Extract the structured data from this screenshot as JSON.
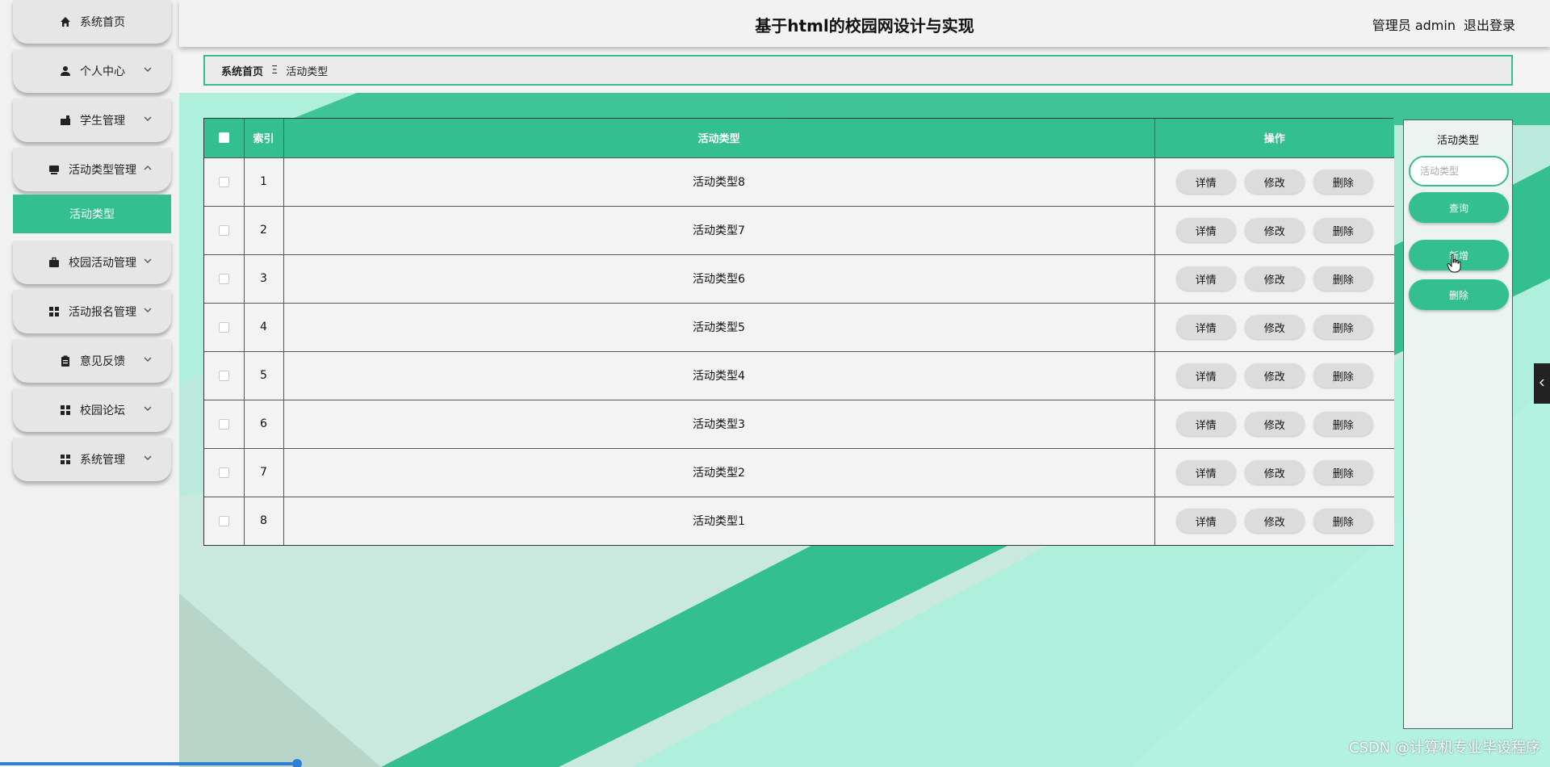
{
  "header": {
    "title": "基于html的校园网设计与实现",
    "user_label": "管理员 admin",
    "logout_label": "退出登录"
  },
  "sidebar": {
    "items": [
      {
        "label": "系统首页",
        "icon": "home-icon",
        "has_chevron": false
      },
      {
        "label": "个人中心",
        "icon": "user-icon",
        "has_chevron": true
      },
      {
        "label": "学生管理",
        "icon": "student-icon",
        "has_chevron": true
      },
      {
        "label": "活动类型管理",
        "icon": "category-icon",
        "has_chevron": true
      },
      {
        "label": "校园活动管理",
        "icon": "briefcase-icon",
        "has_chevron": true
      },
      {
        "label": "活动报名管理",
        "icon": "grid-icon",
        "has_chevron": true
      },
      {
        "label": "意见反馈",
        "icon": "clipboard-icon",
        "has_chevron": true
      },
      {
        "label": "校园论坛",
        "icon": "grid-icon",
        "has_chevron": true
      },
      {
        "label": "系统管理",
        "icon": "grid-icon",
        "has_chevron": true
      }
    ],
    "active_submenu": "活动类型"
  },
  "breadcrumb": {
    "home": "系统首页",
    "separator": "Ξ",
    "current": "活动类型"
  },
  "table": {
    "columns": [
      "索引",
      "活动类型",
      "操作"
    ],
    "actions": [
      "详情",
      "修改",
      "删除"
    ],
    "rows": [
      {
        "index": "1",
        "type": "活动类型8"
      },
      {
        "index": "2",
        "type": "活动类型7"
      },
      {
        "index": "3",
        "type": "活动类型6"
      },
      {
        "index": "4",
        "type": "活动类型5"
      },
      {
        "index": "5",
        "type": "活动类型4"
      },
      {
        "index": "6",
        "type": "活动类型3"
      },
      {
        "index": "7",
        "type": "活动类型2"
      },
      {
        "index": "8",
        "type": "活动类型1"
      }
    ]
  },
  "search_panel": {
    "title": "活动类型",
    "placeholder": "活动类型",
    "query_label": "查询",
    "add_label": "新增",
    "delete_label": "删除"
  },
  "watermark": "CSDN @计算机专业毕设程序",
  "colors": {
    "accent": "#33bf8f",
    "accent_light": "#aef0dc",
    "button_gray": "#dcdcdc"
  }
}
